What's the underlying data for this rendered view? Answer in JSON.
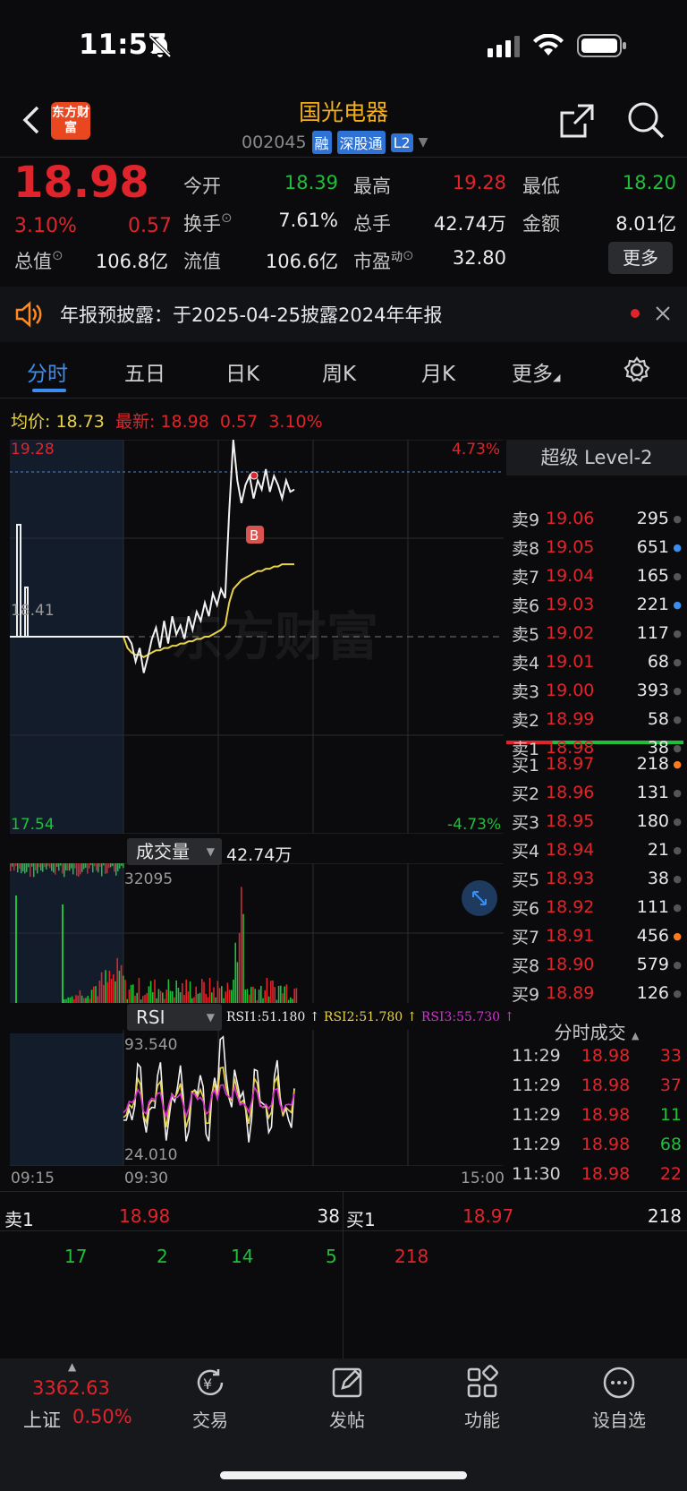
{
  "status_bar": {
    "time": "11:57"
  },
  "header": {
    "logo_text": "东方财富",
    "stock_name": "国光电器",
    "stock_code": "002045",
    "tags": [
      "融",
      "深股通",
      "L2"
    ]
  },
  "quote": {
    "price": "18.98",
    "change_pct": "3.10%",
    "change": "0.57",
    "open_label": "今开",
    "open": "18.39",
    "high_label": "最高",
    "high": "19.28",
    "low_label": "最低",
    "low": "18.20",
    "turnover_label": "换手",
    "turnover": "7.61%",
    "volume_label": "总手",
    "volume": "42.74万",
    "amount_label": "金额",
    "amount": "8.01亿",
    "mktcap_label": "总值",
    "mktcap": "106.8亿",
    "float_label": "流值",
    "float_cap": "106.6亿",
    "pe_label": "市盈",
    "pe_sup": "动",
    "pe": "32.80",
    "more_label": "更多"
  },
  "notice": {
    "text": "年报预披露：于2025-04-25披露2024年年报"
  },
  "tabs": [
    "分时",
    "五日",
    "日K",
    "周K",
    "月K",
    "更多"
  ],
  "avg_row": {
    "avg_label": "均价:",
    "avg": "18.73",
    "latest_label": "最新:",
    "latest": "18.98",
    "chg": "0.57",
    "pct": "3.10%"
  },
  "chart_data": {
    "type": "line",
    "y_top": "19.28",
    "y_bottom": "17.54",
    "pct_top": "4.73%",
    "pct_bottom": "-4.73%",
    "prev_close": "18.41",
    "ylim": [
      17.54,
      19.28
    ],
    "x_labels": [
      "09:15",
      "09:30",
      "15:00"
    ],
    "watermark": "东方财富",
    "trade_marker": "B",
    "price_series": [
      18.41,
      18.41,
      18.38,
      18.3,
      18.36,
      18.25,
      18.32,
      18.4,
      18.45,
      18.36,
      18.48,
      18.38,
      18.5,
      18.42,
      18.46,
      18.4,
      18.5,
      18.44,
      18.52,
      18.48,
      18.56,
      18.5,
      18.6,
      18.55,
      18.62,
      18.58,
      18.96,
      19.28,
      19.1,
      19.0,
      19.08,
      19.12,
      19.02,
      19.1,
      19.06,
      19.15,
      19.05,
      19.12,
      19.08,
      19.02,
      19.1,
      19.05,
      19.06
    ],
    "avg_series": [
      18.41,
      18.36,
      18.34,
      18.33,
      18.33,
      18.32,
      18.33,
      18.34,
      18.35,
      18.35,
      18.36,
      18.36,
      18.37,
      18.37,
      18.38,
      18.38,
      18.39,
      18.39,
      18.4,
      18.4,
      18.41,
      18.41,
      18.42,
      18.43,
      18.44,
      18.46,
      18.56,
      18.62,
      18.64,
      18.66,
      18.67,
      18.68,
      18.69,
      18.7,
      18.7,
      18.71,
      18.71,
      18.72,
      18.72,
      18.73,
      18.73,
      18.73,
      18.73
    ],
    "volume_label": "成交量",
    "volume_total": "42.74万",
    "volume_max": "32095",
    "rsi_label": "RSI",
    "rsi1": "RSI1:51.180 ↑",
    "rsi2": "RSI2:51.780 ↑",
    "rsi3": "RSI3:55.730 ↑",
    "rsi_top": "93.540",
    "rsi_bottom": "24.010"
  },
  "level2": {
    "title": "超级 Level-2",
    "asks": [
      {
        "label": "卖9",
        "price": "19.06",
        "vol": "295"
      },
      {
        "label": "卖8",
        "price": "19.05",
        "vol": "651"
      },
      {
        "label": "卖7",
        "price": "19.04",
        "vol": "165"
      },
      {
        "label": "卖6",
        "price": "19.03",
        "vol": "221"
      },
      {
        "label": "卖5",
        "price": "19.02",
        "vol": "117"
      },
      {
        "label": "卖4",
        "price": "19.01",
        "vol": "68"
      },
      {
        "label": "卖3",
        "price": "19.00",
        "vol": "393"
      },
      {
        "label": "卖2",
        "price": "18.99",
        "vol": "58"
      },
      {
        "label": "卖1",
        "price": "18.98",
        "vol": "38"
      }
    ],
    "bids": [
      {
        "label": "买1",
        "price": "18.97",
        "vol": "218"
      },
      {
        "label": "买2",
        "price": "18.96",
        "vol": "131"
      },
      {
        "label": "买3",
        "price": "18.95",
        "vol": "180"
      },
      {
        "label": "买4",
        "price": "18.94",
        "vol": "21"
      },
      {
        "label": "买5",
        "price": "18.93",
        "vol": "38"
      },
      {
        "label": "买6",
        "price": "18.92",
        "vol": "111"
      },
      {
        "label": "买7",
        "price": "18.91",
        "vol": "456"
      },
      {
        "label": "买8",
        "price": "18.90",
        "vol": "579"
      },
      {
        "label": "买9",
        "price": "18.89",
        "vol": "126"
      }
    ],
    "ticks_title": "分时成交",
    "ticks": [
      {
        "time": "11:29",
        "price": "18.98",
        "vol": "33"
      },
      {
        "time": "11:29",
        "price": "18.98",
        "vol": "37"
      },
      {
        "time": "11:29",
        "price": "18.98",
        "vol": "11"
      },
      {
        "time": "11:29",
        "price": "18.98",
        "vol": "68"
      },
      {
        "time": "11:30",
        "price": "18.98",
        "vol": "22"
      }
    ]
  },
  "bottom_quote": {
    "sell_label": "卖1",
    "sell_price": "18.98",
    "sell_vol": "38",
    "buy_label": "买1",
    "buy_price": "18.97",
    "buy_vol": "218",
    "sell_queue": [
      "17",
      "2",
      "14",
      "5"
    ],
    "buy_queue": [
      "218"
    ]
  },
  "bottom_nav": {
    "index_value": "3362.63",
    "index_name": "上证",
    "index_pct": "0.50%",
    "items": [
      "交易",
      "发帖",
      "功能",
      "设自选"
    ]
  }
}
